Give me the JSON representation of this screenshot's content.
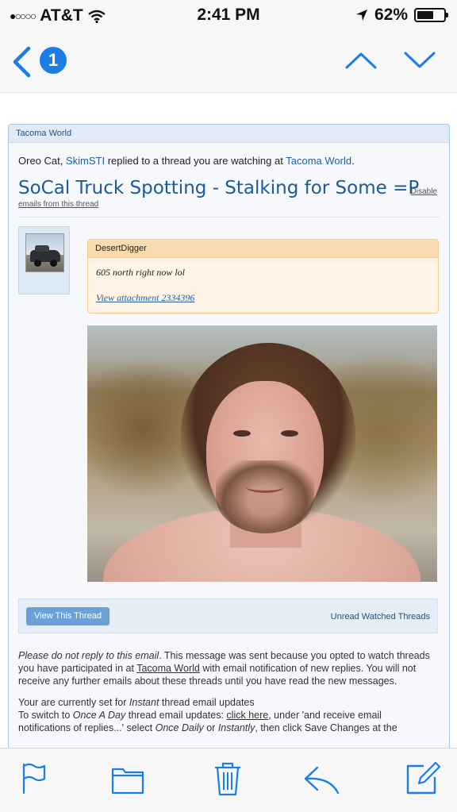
{
  "status_bar": {
    "signal_dots": "●○○○○",
    "carrier": "AT&T",
    "time": "2:41 PM",
    "battery": "62%",
    "battery_level": 0.62
  },
  "nav": {
    "back_count": "1"
  },
  "email": {
    "header_label": "Tacoma World",
    "intro": {
      "prefix": "Oreo Cat, ",
      "user": "SkimSTI",
      "middle": " replied to a thread you are watching at ",
      "site": "Tacoma World",
      "suffix": "."
    },
    "thread_title": "SoCal Truck Spotting - Stalking for Some =P",
    "disable_label": "Disable",
    "emails_from_label": "emails from this thread",
    "post": {
      "author": "DesertDigger",
      "body": "605 north right now lol",
      "attachment_link": "View attachment 2334396"
    },
    "view_thread_button": "View This Thread",
    "unread_link": "Unread Watched Threads",
    "footer": {
      "p1_em": "Please do not reply to this email",
      "p1_a": ". This message was sent because you opted to watch threads you have participated in at ",
      "p1_link": "Tacoma World",
      "p1_b": " with email notification of new replies. You will not receive any further emails about these threads until you have read the new messages.",
      "p2_a": "Your are currently set for ",
      "p2_em1": "Instant",
      "p2_b": " thread email updates",
      "p3_a": "To switch to ",
      "p3_em1": "Once A Day",
      "p3_b": " thread email updates: ",
      "p3_link": "click here",
      "p3_c": ", under 'and receive email notifications of replies...' select ",
      "p3_em2": "Once Daily",
      "p3_d": " or ",
      "p3_em3": "Instantly",
      "p3_e": ", then click Save Changes at the"
    }
  },
  "icons": {
    "accent": "#1a7ee6",
    "toolbar": [
      "flag-icon",
      "folder-icon",
      "trash-icon",
      "reply-icon",
      "compose-icon"
    ]
  }
}
